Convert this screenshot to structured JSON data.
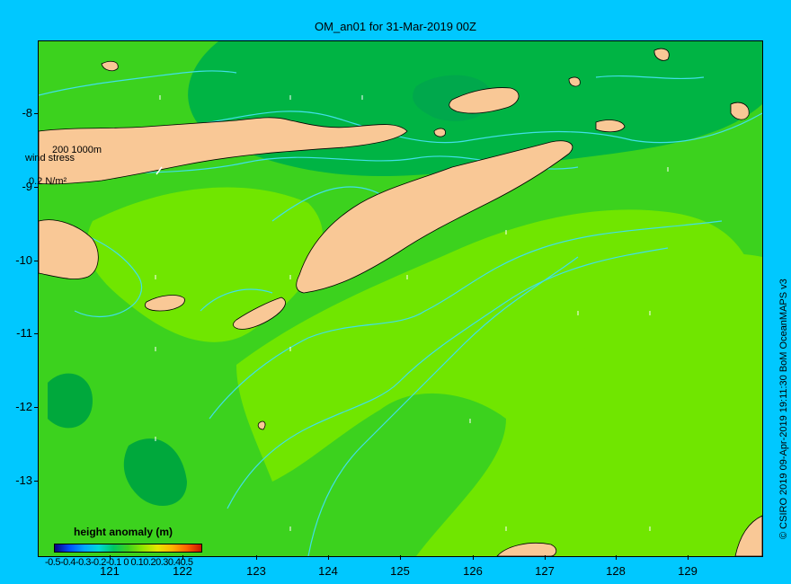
{
  "title": "OM_an01 for 31-Mar-2019 00Z",
  "credit": "© CSIRO 2019   09-Apr-2019 19:11:30 BoM OceanMAPS v3",
  "y_ticks": [
    "-8",
    "-9",
    "-10",
    "-11",
    "-12",
    "-13"
  ],
  "x_ticks": [
    "121",
    "122",
    "123",
    "124",
    "125",
    "126",
    "127",
    "128",
    "129"
  ],
  "colorbar": {
    "title": "height anomaly  (m)",
    "labels": "-0.5-0.4-0.3-0.2-0.1  0  0.10.20.30.40.5"
  },
  "wind_stress": {
    "label": "wind stress",
    "scale": "0.2 N/m²"
  },
  "depth_contours_label": "200  1000m",
  "colors": {
    "background": "#00c8ff",
    "land": "#f9c896",
    "anomaly_low": "#00a83c",
    "anomaly_mid": "#3cd21e",
    "anomaly_high": "#70e600",
    "contour": "#40e0e8"
  },
  "map": {
    "lon_range": [
      120.0,
      130.0
    ],
    "lat_range": [
      -14.0,
      -7.0
    ],
    "projection": "Plate Carrée"
  }
}
